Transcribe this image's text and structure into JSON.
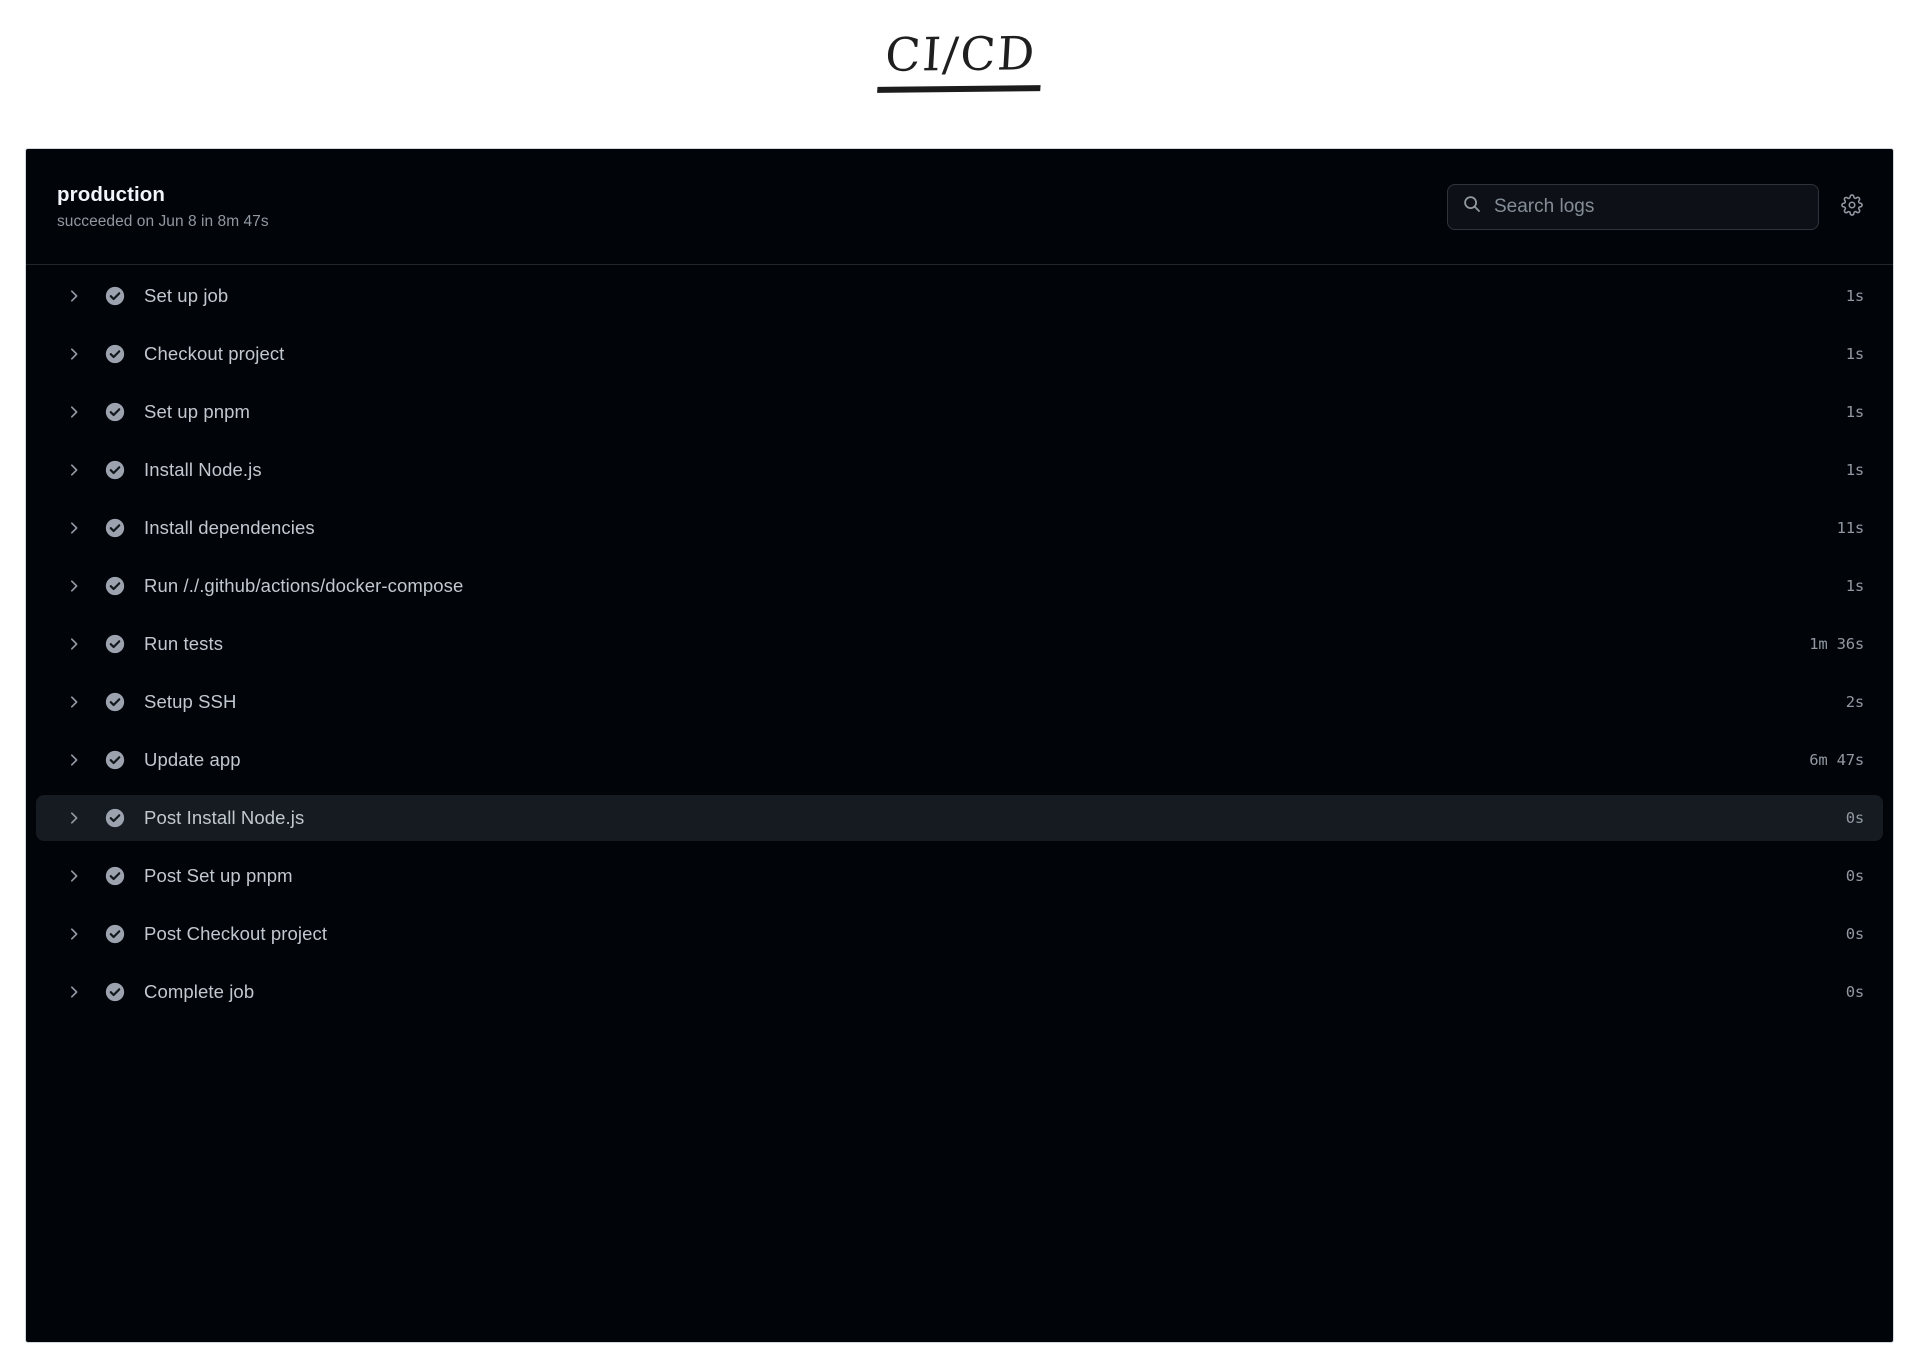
{
  "page": {
    "title": "CI/CD"
  },
  "header": {
    "job_name": "production",
    "job_status": "succeeded on Jun 8 in 8m 47s",
    "search": {
      "placeholder": "Search logs",
      "value": "",
      "icon": "search-icon"
    },
    "settings_icon": "gear-icon"
  },
  "colors": {
    "panel_background": "#010409",
    "panel_border": "#d0d7de",
    "divider": "#21262d",
    "active_row_background": "#161b22",
    "label_text": "#c2c8d0",
    "muted_text": "#9198a1",
    "title_text": "#f0f6fc",
    "status_icon": "#9ca3af",
    "page_background": "#ffffff"
  },
  "steps": [
    {
      "label": "Set up job",
      "duration": "1s",
      "status": "succeeded",
      "expanded": false,
      "active": false
    },
    {
      "label": "Checkout project",
      "duration": "1s",
      "status": "succeeded",
      "expanded": false,
      "active": false
    },
    {
      "label": "Set up pnpm",
      "duration": "1s",
      "status": "succeeded",
      "expanded": false,
      "active": false
    },
    {
      "label": "Install Node.js",
      "duration": "1s",
      "status": "succeeded",
      "expanded": false,
      "active": false
    },
    {
      "label": "Install dependencies",
      "duration": "11s",
      "status": "succeeded",
      "expanded": false,
      "active": false
    },
    {
      "label": "Run /./.github/actions/docker-compose",
      "duration": "1s",
      "status": "succeeded",
      "expanded": false,
      "active": false
    },
    {
      "label": "Run tests",
      "duration": "1m 36s",
      "status": "succeeded",
      "expanded": false,
      "active": false
    },
    {
      "label": "Setup SSH",
      "duration": "2s",
      "status": "succeeded",
      "expanded": false,
      "active": false
    },
    {
      "label": "Update app",
      "duration": "6m 47s",
      "status": "succeeded",
      "expanded": false,
      "active": false
    },
    {
      "label": "Post Install Node.js",
      "duration": "0s",
      "status": "succeeded",
      "expanded": false,
      "active": true
    },
    {
      "label": "Post Set up pnpm",
      "duration": "0s",
      "status": "succeeded",
      "expanded": false,
      "active": false
    },
    {
      "label": "Post Checkout project",
      "duration": "0s",
      "status": "succeeded",
      "expanded": false,
      "active": false
    },
    {
      "label": "Complete job",
      "duration": "0s",
      "status": "succeeded",
      "expanded": false,
      "active": false
    }
  ]
}
